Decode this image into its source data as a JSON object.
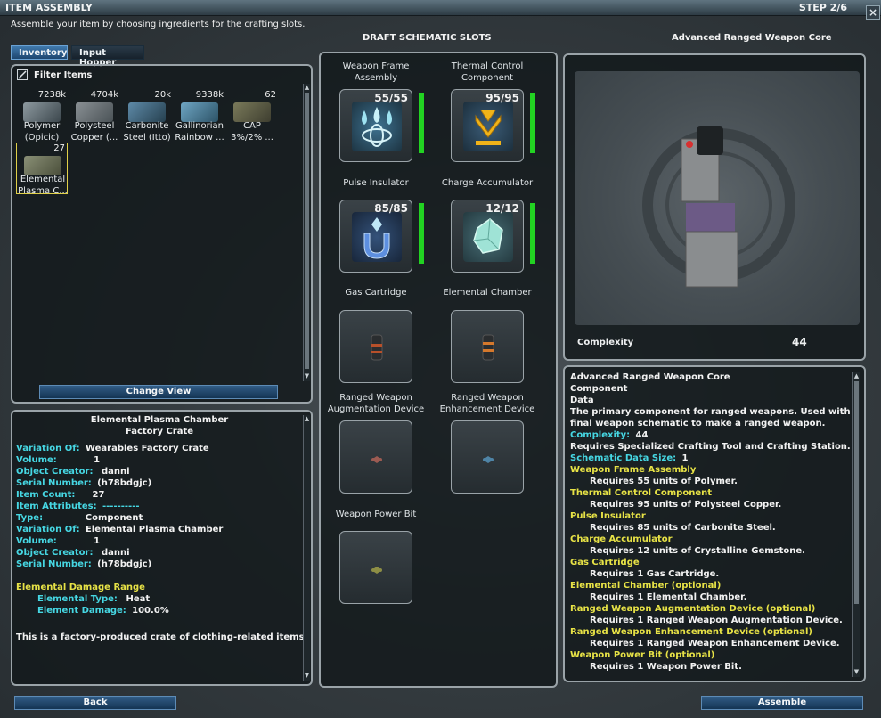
{
  "window": {
    "title": "ITEM ASSEMBLY",
    "step": "STEP 2/6",
    "close_glyph": "×"
  },
  "instructions": "Assemble your item by choosing ingredients for the crafting slots.",
  "tabs": [
    {
      "label": "Inventory",
      "active": true
    },
    {
      "label": "Input Hopper",
      "active": false
    }
  ],
  "filter": {
    "label": "Filter Items"
  },
  "inventory": [
    {
      "count": "7238k",
      "name_line1": "Polymer",
      "name_line2": "(Opicic)",
      "icon": "polymer-icon"
    },
    {
      "count": "4704k",
      "name_line1": "Polysteel",
      "name_line2": "Copper (...",
      "icon": "polysteel-icon"
    },
    {
      "count": "20k",
      "name_line1": "Carbonite",
      "name_line2": "Steel (Itto)",
      "icon": "carbonite-icon"
    },
    {
      "count": "9338k",
      "name_line1": "Gallinorian",
      "name_line2": "Rainbow ...",
      "icon": "gemstone-icon"
    },
    {
      "count": "62",
      "name_line1": "CAP",
      "name_line2": "3%/2% ...",
      "icon": "cap-icon"
    },
    {
      "count": "27",
      "name_line1": "Elemental",
      "name_line2": "Plasma C...",
      "icon": "crate-icon",
      "selected": true
    }
  ],
  "change_view": "Change View",
  "details": {
    "title": "Elemental Plasma Chamber",
    "subtitle": "Factory Crate",
    "rows": [
      {
        "k": "Variation Of:",
        "v": "Wearables Factory Crate"
      },
      {
        "k": "Volume:",
        "v": "1"
      },
      {
        "k": "Object Creator:",
        "v": "danni"
      },
      {
        "k": "Serial Number:",
        "v": "(h78bdgjc)"
      },
      {
        "k": "Item Count:",
        "v": "27"
      },
      {
        "k": "Item Attributes:",
        "v": "----------"
      },
      {
        "k": "Type:",
        "v": "Component"
      },
      {
        "k": "Variation Of:",
        "v": "Elemental Plasma Chamber"
      },
      {
        "k": "Volume:",
        "v": "1"
      },
      {
        "k": "Object Creator:",
        "v": "danni"
      },
      {
        "k": "Serial Number:",
        "v": "(h78bdgjc)"
      }
    ],
    "damage_header": "Elemental Damage Range",
    "damage_rows": [
      {
        "k": "Elemental Type:",
        "v": "Heat"
      },
      {
        "k": "Element Damage:",
        "v": "100.0%"
      }
    ],
    "footer": "This is a factory-produced crate of clothing-related items."
  },
  "schematic": {
    "header": "DRAFT SCHEMATIC SLOTS",
    "slots": [
      {
        "line1": "Weapon Frame",
        "line2": "Assembly",
        "count": "55/55",
        "fill": 1.0,
        "icon": "water-drops-icon",
        "filled": true
      },
      {
        "line1": "Thermal Control",
        "line2": "Component",
        "count": "95/95",
        "fill": 1.0,
        "icon": "thermal-chevron-icon",
        "filled": true
      },
      {
        "line1": "Pulse Insulator",
        "line2": "",
        "count": "85/85",
        "fill": 1.0,
        "icon": "magnet-icon",
        "filled": true
      },
      {
        "line1": "Charge Accumulator",
        "line2": "",
        "count": "12/12",
        "fill": 1.0,
        "icon": "crystal-icon",
        "filled": true
      },
      {
        "line1": "Gas Cartridge",
        "line2": "",
        "count": "",
        "icon": "cartridge-icon",
        "filled": false
      },
      {
        "line1": "Elemental Chamber",
        "line2": "",
        "count": "",
        "icon": "chamber-icon",
        "filled": false
      },
      {
        "line1": "Ranged Weapon",
        "line2": "Augmentation Device",
        "count": "",
        "icon": "augment-icon",
        "filled": false
      },
      {
        "line1": "Ranged Weapon",
        "line2": "Enhancement Device",
        "count": "",
        "icon": "enhance-icon",
        "filled": false
      },
      {
        "line1": "Weapon Power Bit",
        "line2": "",
        "count": "",
        "icon": "power-bit-icon",
        "filled": false
      }
    ]
  },
  "product": {
    "name": "Advanced Ranged Weapon Core",
    "complexity_label": "Complexity",
    "complexity_value": "44"
  },
  "description": [
    {
      "t": "Advanced Ranged Weapon Core",
      "s": "w"
    },
    {
      "t": "Component",
      "s": "w"
    },
    {
      "t": "Data",
      "s": "w"
    },
    {
      "t": "The primary component for ranged weapons. Used with a",
      "s": "n"
    },
    {
      "t": "final weapon schematic to make a ranged weapon.",
      "s": "n"
    },
    {
      "k": "Complexity:",
      "v": "44",
      "s": "kv"
    },
    {
      "t": "Requires Specialized Crafting Tool and Crafting Station.",
      "s": "n"
    },
    {
      "k": "Schematic Data Size:",
      "v": "1",
      "s": "kv"
    },
    {
      "t": "Weapon Frame Assembly",
      "s": "y"
    },
    {
      "t": "Requires 55 units of Polymer.",
      "s": "i"
    },
    {
      "t": "Thermal Control Component",
      "s": "y"
    },
    {
      "t": "Requires 95 units of Polysteel Copper.",
      "s": "i"
    },
    {
      "t": "Pulse Insulator",
      "s": "y"
    },
    {
      "t": "Requires 85 units of Carbonite Steel.",
      "s": "i"
    },
    {
      "t": "Charge Accumulator",
      "s": "y"
    },
    {
      "t": "Requires 12 units of Crystalline Gemstone.",
      "s": "i"
    },
    {
      "t": "Gas Cartridge",
      "s": "y"
    },
    {
      "t": "Requires 1 Gas Cartridge.",
      "s": "i"
    },
    {
      "t": "Elemental Chamber (optional)",
      "s": "y"
    },
    {
      "t": "Requires 1 Elemental Chamber.",
      "s": "i"
    },
    {
      "t": "Ranged Weapon Augmentation Device (optional)",
      "s": "y"
    },
    {
      "t": "Requires 1 Ranged Weapon Augmentation Device.",
      "s": "i"
    },
    {
      "t": "Ranged Weapon Enhancement Device (optional)",
      "s": "y"
    },
    {
      "t": "Requires 1 Ranged Weapon Enhancement Device.",
      "s": "i"
    },
    {
      "t": "Weapon Power Bit (optional)",
      "s": "y"
    },
    {
      "t": "Requires 1 Weapon Power Bit.",
      "s": "i"
    }
  ],
  "buttons": {
    "back": "Back",
    "assemble": "Assemble"
  },
  "colors": {
    "accent_blue": "#2a5a8a",
    "attr_cyan": "#46d7e3",
    "header_yellow": "#e7e246",
    "fill_green": "#22d322"
  }
}
